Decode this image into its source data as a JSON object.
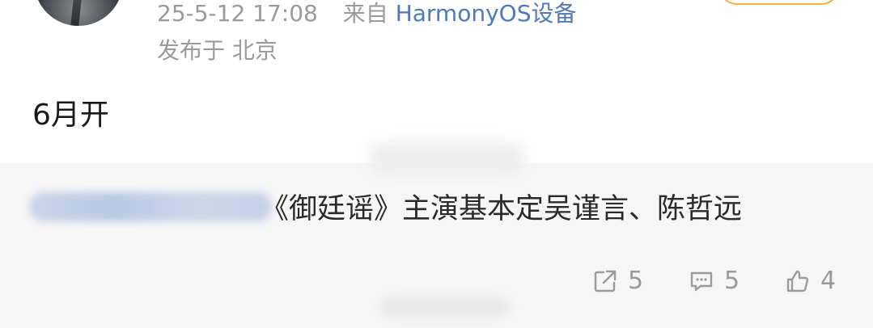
{
  "post": {
    "timestamp": "25-5-12 17:08",
    "source_prefix": "来自",
    "source": "HarmonyOS设备",
    "location": "发布于 北京",
    "text": "6月开"
  },
  "repost": {
    "text": "《御廷谣》主演基本定吴谨言、陈哲远"
  },
  "actions": {
    "share_count": "5",
    "comment_count": "5",
    "like_count": "4"
  },
  "colors": {
    "link_blue": "#4f79b8",
    "meta_gray": "#9a9a9a",
    "follow_orange": "#f6b23f"
  },
  "icons": {
    "share": "share-icon",
    "comment": "comment-icon",
    "like": "thumbs-up-icon"
  }
}
